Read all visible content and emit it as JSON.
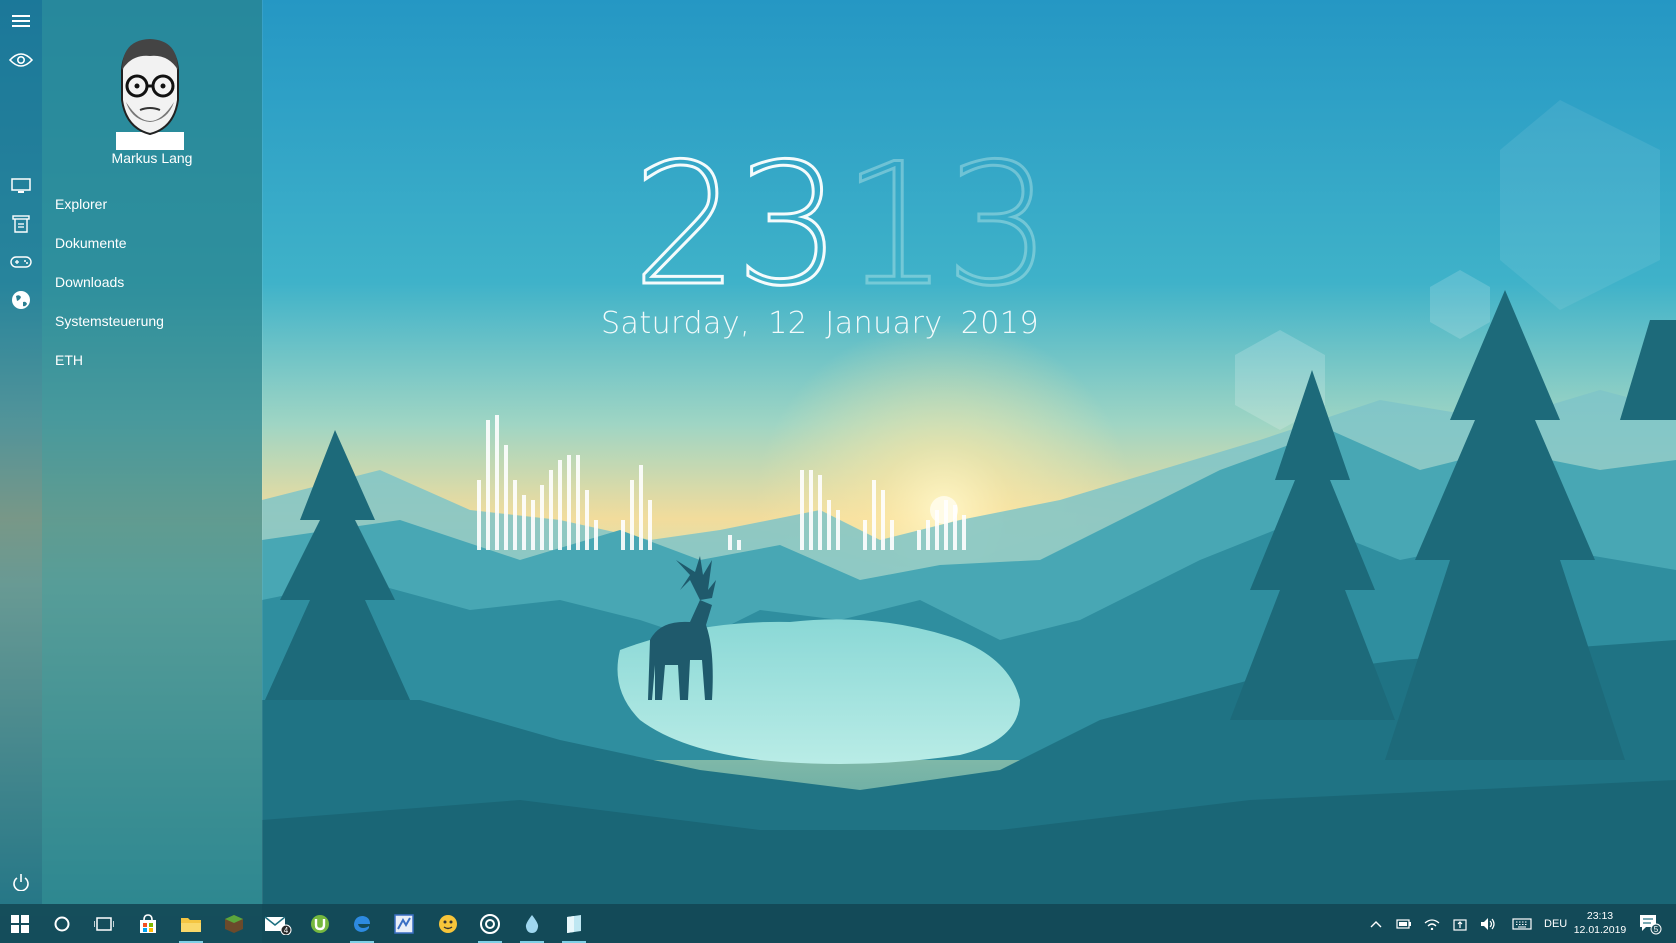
{
  "clock": {
    "hours": "23",
    "minutes": "13",
    "date": "Saturday, 12 January 2019"
  },
  "start_menu": {
    "user_name": "Markus Lang",
    "items": [
      {
        "label": "Explorer",
        "icon": "monitor-icon"
      },
      {
        "label": "Dokumente",
        "icon": "document-icon"
      },
      {
        "label": "Downloads",
        "icon": "gamepad-icon"
      },
      {
        "label": "Systemsteuerung",
        "icon": "globe-icon"
      },
      {
        "label": "ETH",
        "icon": ""
      }
    ],
    "top_icons": [
      "hamburger-menu-icon",
      "eye-icon"
    ],
    "bottom_icon": "power-icon"
  },
  "taskbar": {
    "pinned": [
      {
        "icon": "windows-start-icon"
      },
      {
        "icon": "cortana-circle-icon"
      },
      {
        "icon": "task-view-icon"
      },
      {
        "icon": "store-bag-icon"
      },
      {
        "icon": "file-explorer-icon"
      },
      {
        "icon": "minecraft-block-icon"
      },
      {
        "icon": "mail-icon",
        "badge": "4"
      },
      {
        "icon": "utorrent-icon"
      },
      {
        "icon": "edge-browser-icon"
      },
      {
        "icon": "blue-app-icon"
      },
      {
        "icon": "emoji-app-icon"
      },
      {
        "icon": "target-ring-icon"
      },
      {
        "icon": "water-drop-icon"
      },
      {
        "icon": "notes-app-icon"
      }
    ],
    "tray": {
      "icons": [
        "chevron-up-icon",
        "battery-icon",
        "wifi-icon",
        "usb-icon",
        "volume-icon",
        "keyboard-icon"
      ],
      "language": "DEU",
      "time": "23:13",
      "date": "12.01.2019",
      "notification_count": "5"
    }
  },
  "colors": {
    "accent": "#7fd0e6",
    "sky_top": "#2aa1c9",
    "sun": "#ffe9a6"
  }
}
